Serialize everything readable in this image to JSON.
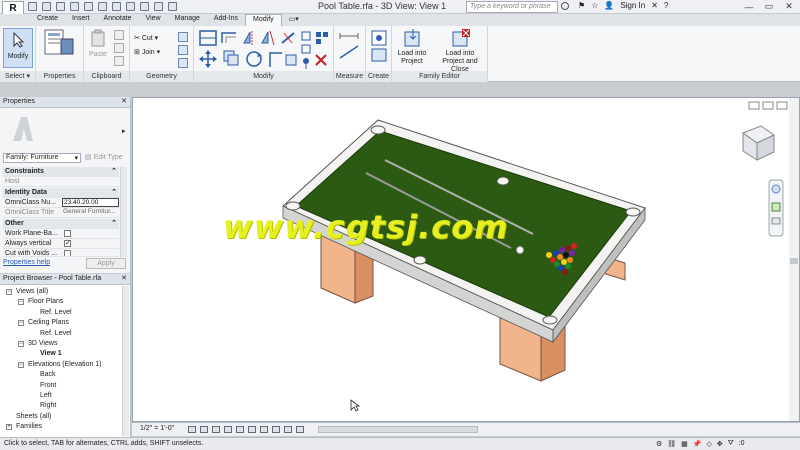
{
  "app": {
    "button_letter": "R",
    "title": "Pool Table.rfa - 3D View: View 1",
    "search_placeholder": "Type a keyword or phrase",
    "sign_in": "Sign In"
  },
  "tabs": [
    "Create",
    "Insert",
    "Annotate",
    "View",
    "Manage",
    "Add-Ins",
    "Modify"
  ],
  "ribbon": {
    "select": {
      "label": "Modify",
      "panel": "Select"
    },
    "properties": {
      "panel": "Properties"
    },
    "clipboard": {
      "paste": "Paste",
      "panel": "Clipboard"
    },
    "geometry": {
      "cut": "Cut",
      "join": "Join",
      "panel": "Geometry"
    },
    "modify": {
      "panel": "Modify"
    },
    "measure": {
      "panel": "Measure"
    },
    "create": {
      "panel": "Create"
    },
    "family_editor": {
      "load_into_project": "Load into\nProject",
      "load_close": "Load into\nProject and Close",
      "panel": "Family Editor"
    }
  },
  "properties": {
    "title": "Properties",
    "type_selector": "Family: Furniture",
    "edit_type": "Edit Type",
    "rows": [
      {
        "k": "Constraints",
        "cat": true
      },
      {
        "k": "Host",
        "v": ""
      },
      {
        "k": "Identity Data",
        "cat": true
      },
      {
        "k": "OmniClass Nu...",
        "v": "23.40.20.00"
      },
      {
        "k": "OmniClass Title",
        "v": "General Furnitur..."
      },
      {
        "k": "Other",
        "cat": true
      },
      {
        "k": "Work Plane-Ba...",
        "check": ""
      },
      {
        "k": "Always vertical",
        "check": "✓"
      },
      {
        "k": "Cut with Voids ...",
        "check": ""
      }
    ],
    "help_link": "Properties help",
    "apply": "Apply"
  },
  "browser": {
    "title": "Project Browser - Pool Table.rfa",
    "items": [
      {
        "label": "Views (all)",
        "indent": 0,
        "twisty": "−"
      },
      {
        "label": "Floor Plans",
        "indent": 1,
        "twisty": "−"
      },
      {
        "label": "Ref. Level",
        "indent": 2
      },
      {
        "label": "Ceiling Plans",
        "indent": 1,
        "twisty": "−"
      },
      {
        "label": "Ref. Level",
        "indent": 2
      },
      {
        "label": "3D Views",
        "indent": 1,
        "twisty": "−"
      },
      {
        "label": "View 1",
        "indent": 2,
        "bold": true
      },
      {
        "label": "Elevations (Elevation 1)",
        "indent": 1,
        "twisty": "−"
      },
      {
        "label": "Back",
        "indent": 2
      },
      {
        "label": "Front",
        "indent": 2
      },
      {
        "label": "Left",
        "indent": 2
      },
      {
        "label": "Right",
        "indent": 2
      },
      {
        "label": "Sheets (all)",
        "indent": 0
      },
      {
        "label": "Families",
        "indent": 0,
        "twisty": "+"
      }
    ]
  },
  "view_control": {
    "scale": "1/2\" = 1'-0\""
  },
  "watermark": "www.cgtsj.com",
  "status": {
    "text": "Click to select, TAB for alternates, CTRL adds, SHIFT unselects.",
    "filter": ":0"
  },
  "colors": {
    "felt": "#2c5a12",
    "rail": "#f1f1ef",
    "leg": "#eba57c",
    "watermark": "#e6f01f"
  }
}
